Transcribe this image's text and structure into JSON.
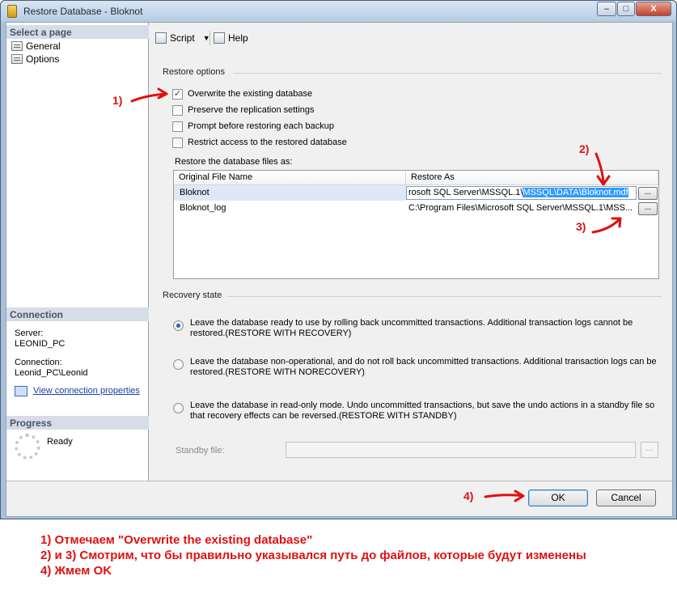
{
  "window": {
    "title": "Restore Database - Bloknot",
    "minimize": "–",
    "maximize": "□",
    "close": "X"
  },
  "sidebar": {
    "select_page_header": "Select a page",
    "pages": [
      {
        "label": "General"
      },
      {
        "label": "Options"
      }
    ],
    "connection_header": "Connection",
    "server_label": "Server:",
    "server_value": "LEONID_PC",
    "connection_label": "Connection:",
    "connection_value": "Leonid_PC\\Leonid",
    "view_connection_link": "View connection properties",
    "progress_header": "Progress",
    "progress_status": "Ready"
  },
  "toolbar": {
    "script_label": "Script",
    "help_label": "Help"
  },
  "restore_options": {
    "group_label": "Restore options",
    "checkboxes": [
      {
        "label": "Overwrite the existing database",
        "checked": true
      },
      {
        "label": "Preserve the replication settings",
        "checked": false
      },
      {
        "label": "Prompt before restoring each backup",
        "checked": false
      },
      {
        "label": "Restrict access to the restored database",
        "checked": false
      }
    ],
    "files_label": "Restore the database files as:",
    "columns": [
      "Original File Name",
      "Restore As"
    ],
    "rows": [
      {
        "original": "Bloknot",
        "restore_as_plain": "rosoft SQL Server\\MSSQL.1\\",
        "restore_as_highlight": "MSSQL\\DATA\\Bloknot.mdf"
      },
      {
        "original": "Bloknot_log",
        "restore_as": "C:\\Program Files\\Microsoft SQL Server\\MSSQL.1\\MSS..."
      }
    ],
    "browse_label": "..."
  },
  "recovery_state": {
    "group_label": "Recovery state",
    "options": [
      {
        "label": "Leave the database ready to use by rolling back uncommitted transactions. Additional transaction logs cannot be restored.(RESTORE WITH RECOVERY)",
        "selected": true
      },
      {
        "label": "Leave the database non-operational, and do not roll back uncommitted transactions. Additional transaction logs can be restored.(RESTORE WITH NORECOVERY)",
        "selected": false
      },
      {
        "label": "Leave the database in read-only mode. Undo uncommitted transactions, but save the undo actions in a standby file so that recovery effects can be reversed.(RESTORE WITH STANDBY)",
        "selected": false
      }
    ],
    "standby_label": "Standby file:",
    "standby_value": "",
    "standby_browse": "..."
  },
  "buttons": {
    "ok": "OK",
    "cancel": "Cancel"
  },
  "annotations": {
    "step1": "1)",
    "step2": "2)",
    "step3": "3)",
    "step4": "4)",
    "notes": [
      "1) Отмечаем \"Overwrite the existing database\"",
      "2) и 3) Смотрим, что бы правильно указывался путь до файлов, которые будут изменены",
      "4) Жмем OK"
    ]
  },
  "colors": {
    "annotation": "#e01010",
    "selection": "#3399ff",
    "section_header": "#d6dde8"
  }
}
